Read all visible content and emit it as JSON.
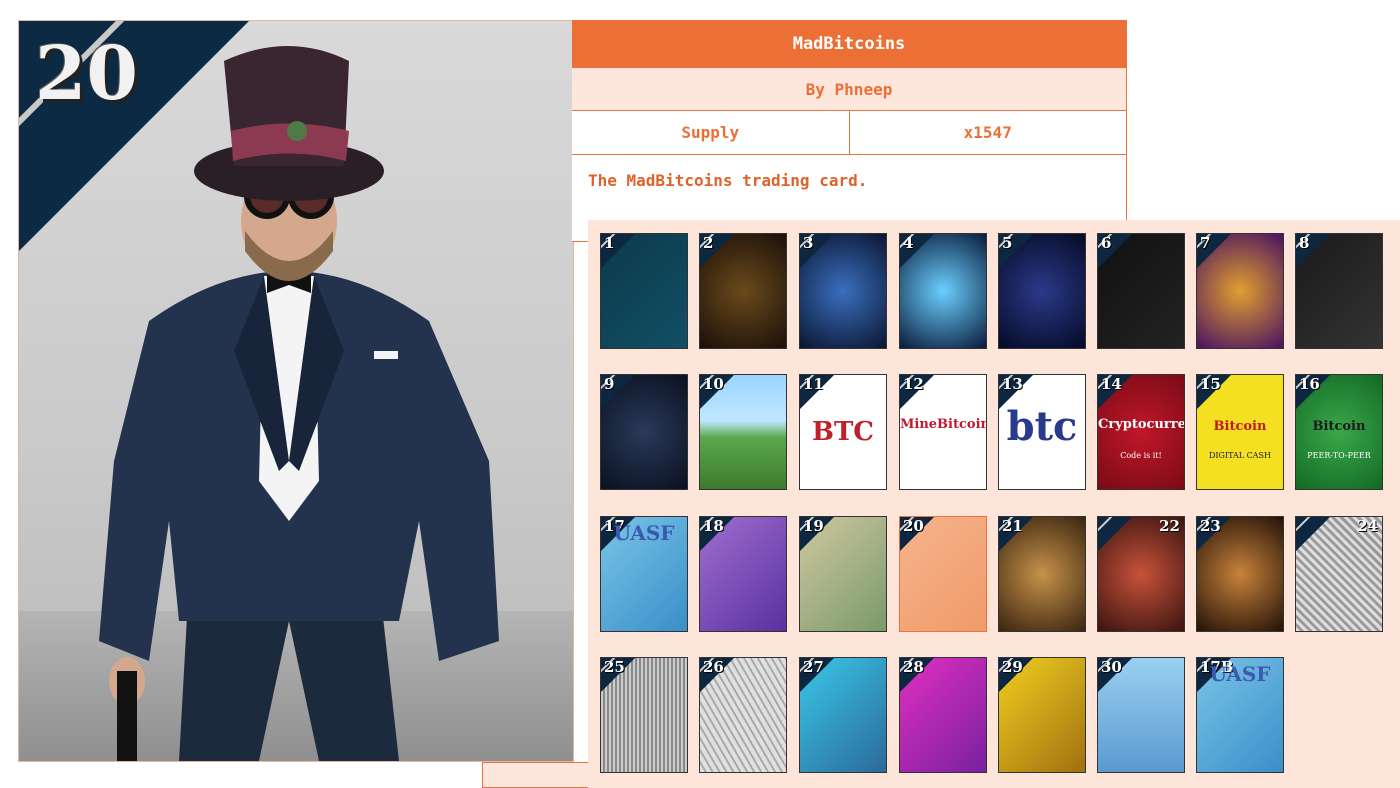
{
  "main_card": {
    "number": "20"
  },
  "info": {
    "title": "MadBitcoins",
    "by": "By Phneep",
    "supply_label": "Supply",
    "supply_value": "x1547",
    "description": "The MadBitcoins trading card."
  },
  "cards": [
    {
      "n": "1"
    },
    {
      "n": "2"
    },
    {
      "n": "3"
    },
    {
      "n": "4"
    },
    {
      "n": "5"
    },
    {
      "n": "6"
    },
    {
      "n": "7"
    },
    {
      "n": "8"
    },
    {
      "n": "9"
    },
    {
      "n": "10"
    },
    {
      "n": "11",
      "text": "BTC"
    },
    {
      "n": "12",
      "text": "MineBitcoin"
    },
    {
      "n": "13",
      "text": "btc"
    },
    {
      "n": "14",
      "text": "Cryptocurrency",
      "sub": "Code is it!"
    },
    {
      "n": "15",
      "text": "Bitcoin",
      "sub": "DIGITAL CASH"
    },
    {
      "n": "16",
      "text": "Bitcoin",
      "sub": "PEER-TO-PEER"
    },
    {
      "n": "17",
      "text": "UASF"
    },
    {
      "n": "18"
    },
    {
      "n": "19"
    },
    {
      "n": "20"
    },
    {
      "n": "21"
    },
    {
      "n": "22"
    },
    {
      "n": "23"
    },
    {
      "n": "24"
    },
    {
      "n": "25"
    },
    {
      "n": "26"
    },
    {
      "n": "27"
    },
    {
      "n": "28"
    },
    {
      "n": "29"
    },
    {
      "n": "30"
    },
    {
      "n": "17B",
      "text": "UASF"
    }
  ],
  "colors": {
    "accent": "#ec6f35",
    "panel_bg": "#fde5da"
  }
}
